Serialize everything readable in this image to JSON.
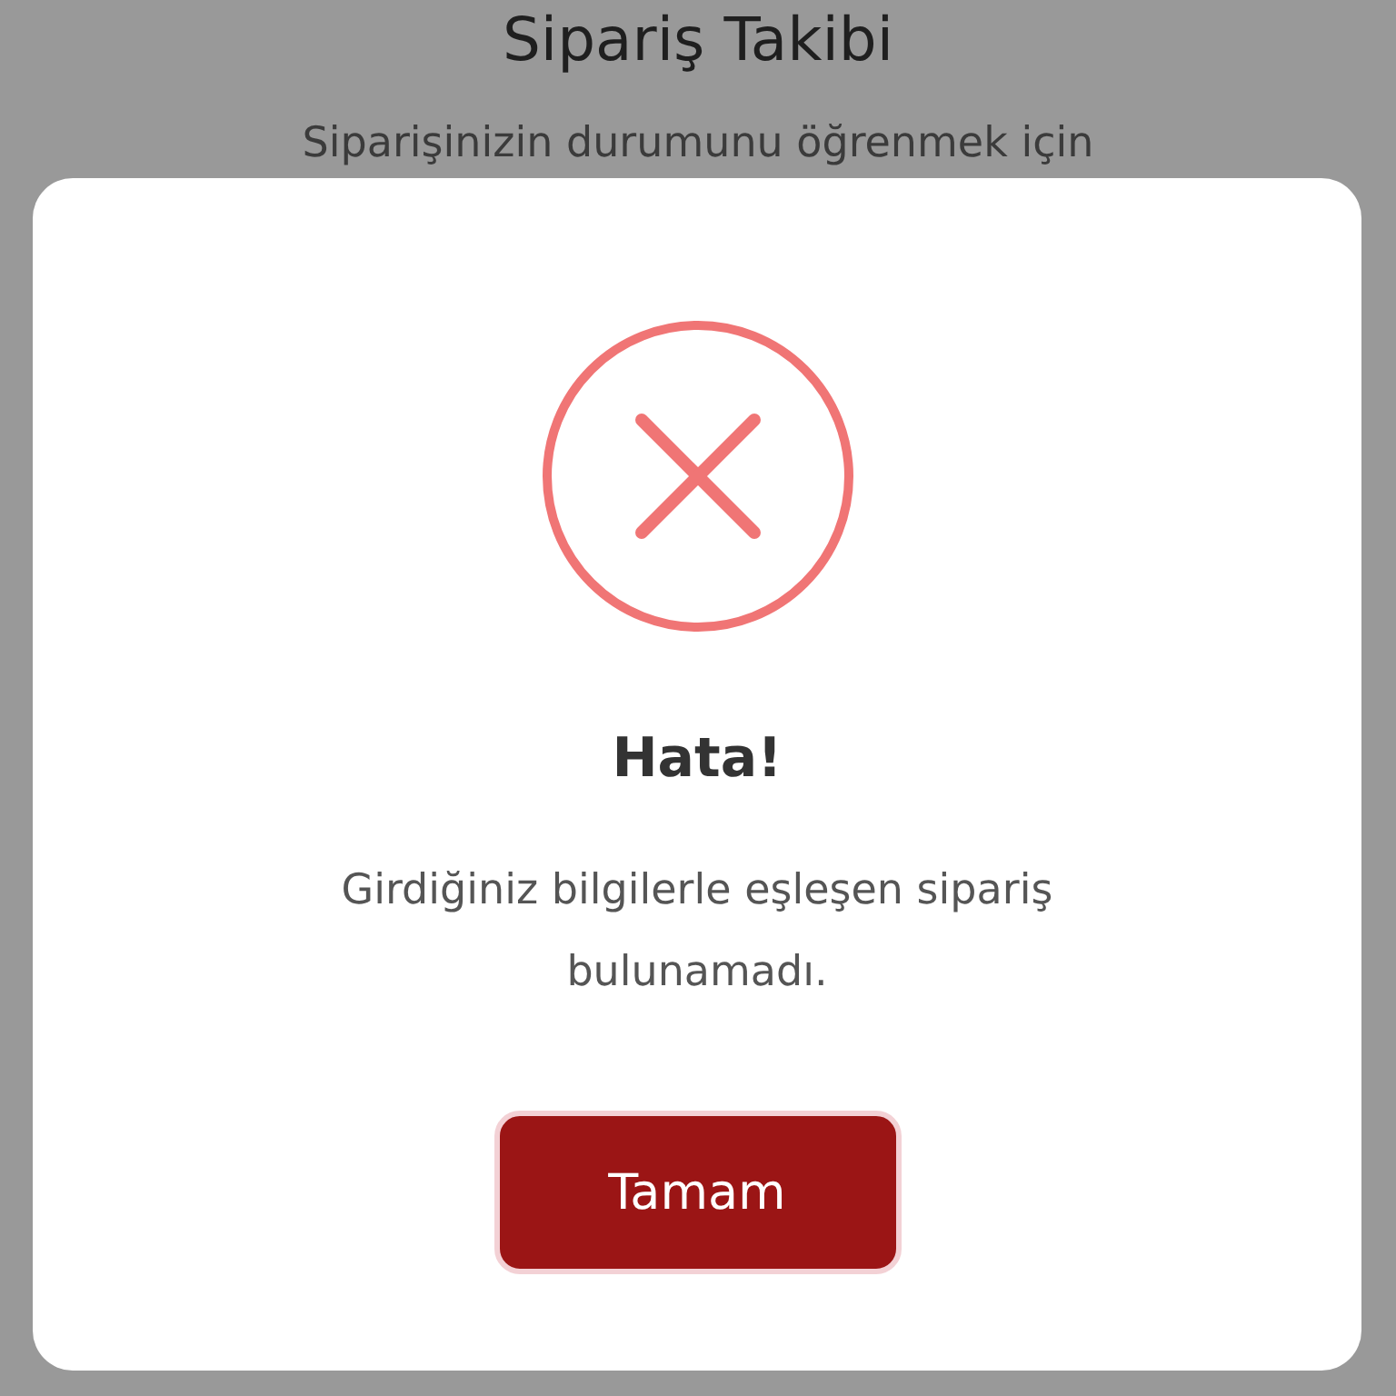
{
  "page": {
    "title": "Sipariş Takibi",
    "subtitle": "Siparişinizin durumunu öğrenmek için"
  },
  "dialog": {
    "kind": "error",
    "title": "Hata!",
    "message": "Girdiğiniz bilgilerle eşleşen sipariş bulunamadı.",
    "buttons": [
      {
        "label": "Tamam",
        "focused": true
      }
    ]
  }
}
